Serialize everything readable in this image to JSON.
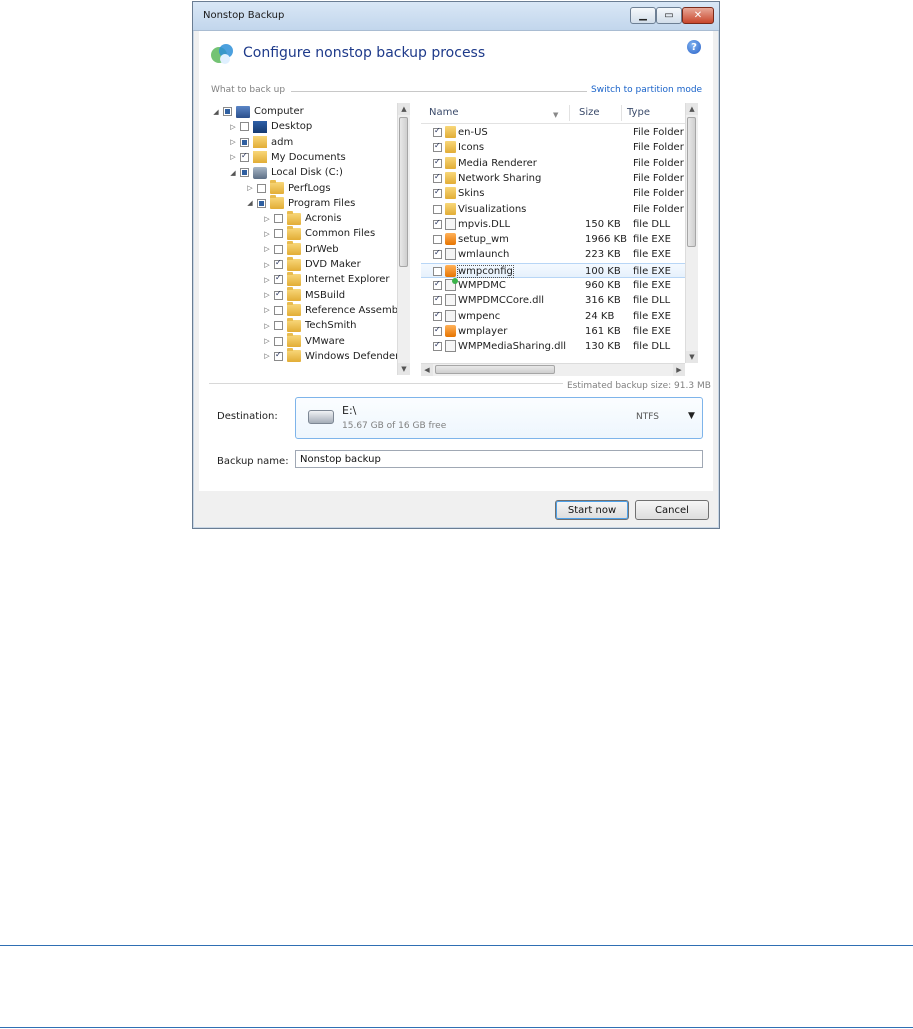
{
  "window": {
    "title": "Nonstop Backup",
    "minimize_glyph": "▁",
    "maximize_glyph": "▭",
    "close_glyph": "✕"
  },
  "header": {
    "title": "Configure nonstop backup process",
    "help_glyph": "?"
  },
  "what_to_back_up": {
    "label": "What to back up",
    "switch_link": "Switch to partition mode"
  },
  "tree": {
    "items": [
      {
        "label": "Computer",
        "depth": 0,
        "expander": "◢",
        "check": "partial",
        "icon": "computer"
      },
      {
        "label": "Desktop",
        "depth": 1,
        "expander": "▷",
        "check": "none",
        "icon": "desktop"
      },
      {
        "label": "adm",
        "depth": 1,
        "expander": "▷",
        "check": "partial",
        "icon": "user"
      },
      {
        "label": "My Documents",
        "depth": 1,
        "expander": "▷",
        "check": "checked",
        "icon": "docs"
      },
      {
        "label": "Local Disk (C:)",
        "depth": 1,
        "expander": "◢",
        "check": "partial",
        "icon": "disk"
      },
      {
        "label": "PerfLogs",
        "depth": 2,
        "expander": "▷",
        "check": "none",
        "icon": "folder"
      },
      {
        "label": "Program Files",
        "depth": 2,
        "expander": "◢",
        "check": "partial",
        "icon": "folder"
      },
      {
        "label": "Acronis",
        "depth": 3,
        "expander": "▷",
        "check": "none",
        "icon": "folder"
      },
      {
        "label": "Common Files",
        "depth": 3,
        "expander": "▷",
        "check": "none",
        "icon": "folder"
      },
      {
        "label": "DrWeb",
        "depth": 3,
        "expander": "▷",
        "check": "none",
        "icon": "folder"
      },
      {
        "label": "DVD Maker",
        "depth": 3,
        "expander": "▷",
        "check": "checked",
        "icon": "folder"
      },
      {
        "label": "Internet Explorer",
        "depth": 3,
        "expander": "▷",
        "check": "checked",
        "icon": "folder"
      },
      {
        "label": "MSBuild",
        "depth": 3,
        "expander": "▷",
        "check": "checked",
        "icon": "folder"
      },
      {
        "label": "Reference Assemb...",
        "depth": 3,
        "expander": "▷",
        "check": "none",
        "icon": "folder"
      },
      {
        "label": "TechSmith",
        "depth": 3,
        "expander": "▷",
        "check": "none",
        "icon": "folder"
      },
      {
        "label": "VMware",
        "depth": 3,
        "expander": "▷",
        "check": "none",
        "icon": "folder"
      },
      {
        "label": "Windows Defender",
        "depth": 3,
        "expander": "▷",
        "check": "checked",
        "icon": "folder"
      }
    ]
  },
  "files": {
    "columns": {
      "name": "Name",
      "size": "Size",
      "type": "Type"
    },
    "rows": [
      {
        "name": "en-US",
        "size": "",
        "type": "File Folder",
        "checked": true,
        "icon": "folder"
      },
      {
        "name": "Icons",
        "size": "",
        "type": "File Folder",
        "checked": true,
        "icon": "folder"
      },
      {
        "name": "Media Renderer",
        "size": "",
        "type": "File Folder",
        "checked": true,
        "icon": "folder"
      },
      {
        "name": "Network Sharing",
        "size": "",
        "type": "File Folder",
        "checked": true,
        "icon": "folder"
      },
      {
        "name": "Skins",
        "size": "",
        "type": "File Folder",
        "checked": true,
        "icon": "folder"
      },
      {
        "name": "Visualizations",
        "size": "",
        "type": "File Folder",
        "checked": false,
        "icon": "folder"
      },
      {
        "name": "mpvis.DLL",
        "size": "150 KB",
        "type": "file DLL",
        "checked": true,
        "icon": "dll"
      },
      {
        "name": "setup_wm",
        "size": "1966 KB",
        "type": "file EXE",
        "checked": false,
        "icon": "media"
      },
      {
        "name": "wmlaunch",
        "size": "223 KB",
        "type": "file EXE",
        "checked": true,
        "icon": "exe"
      },
      {
        "name": "wmpconfig",
        "size": "100 KB",
        "type": "file EXE",
        "checked": false,
        "icon": "media"
      },
      {
        "name": "WMPDMC",
        "size": "960 KB",
        "type": "file EXE",
        "checked": true,
        "icon": "green"
      },
      {
        "name": "WMPDMCCore.dll",
        "size": "316 KB",
        "type": "file DLL",
        "checked": true,
        "icon": "dll"
      },
      {
        "name": "wmpenc",
        "size": "24 KB",
        "type": "file EXE",
        "checked": true,
        "icon": "exe"
      },
      {
        "name": "wmplayer",
        "size": "161 KB",
        "type": "file EXE",
        "checked": true,
        "icon": "media"
      },
      {
        "name": "WMPMediaSharing.dll",
        "size": "130 KB",
        "type": "file DLL",
        "checked": true,
        "icon": "dll"
      }
    ]
  },
  "estimate": "Estimated backup size: 91.3 MB",
  "destination": {
    "label": "Destination:",
    "drive": "E:\\",
    "free": "15.67 GB of 16 GB free",
    "filesystem": "NTFS",
    "arrow": "▼"
  },
  "backup_name": {
    "label": "Backup name:",
    "value": "Nonstop backup"
  },
  "buttons": {
    "start": "Start now",
    "cancel": "Cancel"
  },
  "scroll_glyphs": {
    "up": "▲",
    "down": "▼",
    "left": "◀",
    "right": "▶"
  }
}
